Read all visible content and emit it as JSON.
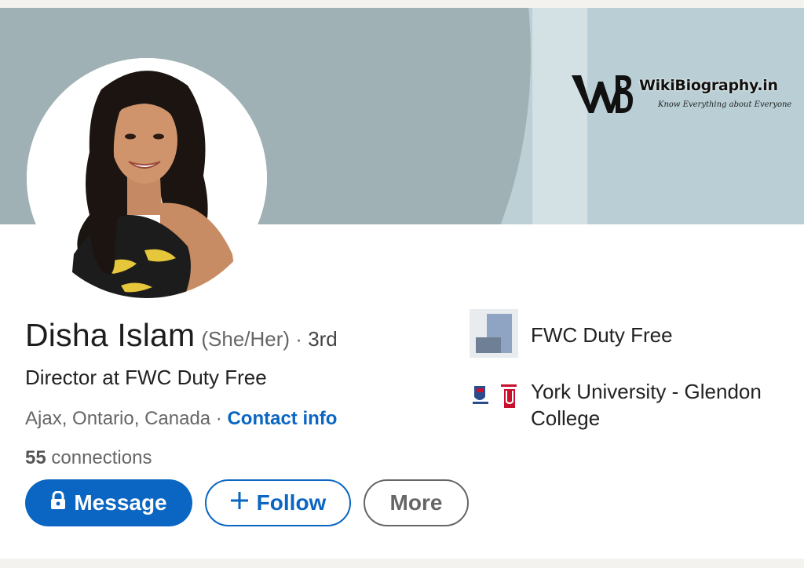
{
  "watermark": {
    "logo_text": "WB",
    "title": "WikiBiography.in",
    "tagline": "Know Everything about Everyone"
  },
  "profile": {
    "name": "Disha Islam",
    "pronouns": "(She/Her)",
    "separator": " · ",
    "degree": "3rd",
    "headline": "Director at FWC Duty Free",
    "location": "Ajax, Ontario, Canada",
    "contact_info": "Contact info",
    "connections_count": "55",
    "connections_label": "connections"
  },
  "actions": {
    "message": "Message",
    "follow": "Follow",
    "more": "More"
  },
  "experience": {
    "company": "FWC Duty Free"
  },
  "education": {
    "school": "York University - Glendon College"
  },
  "colors": {
    "primary": "#0a66c2",
    "cover_dark": "#9fb1b4",
    "cover_light": "#bcd0d6"
  }
}
